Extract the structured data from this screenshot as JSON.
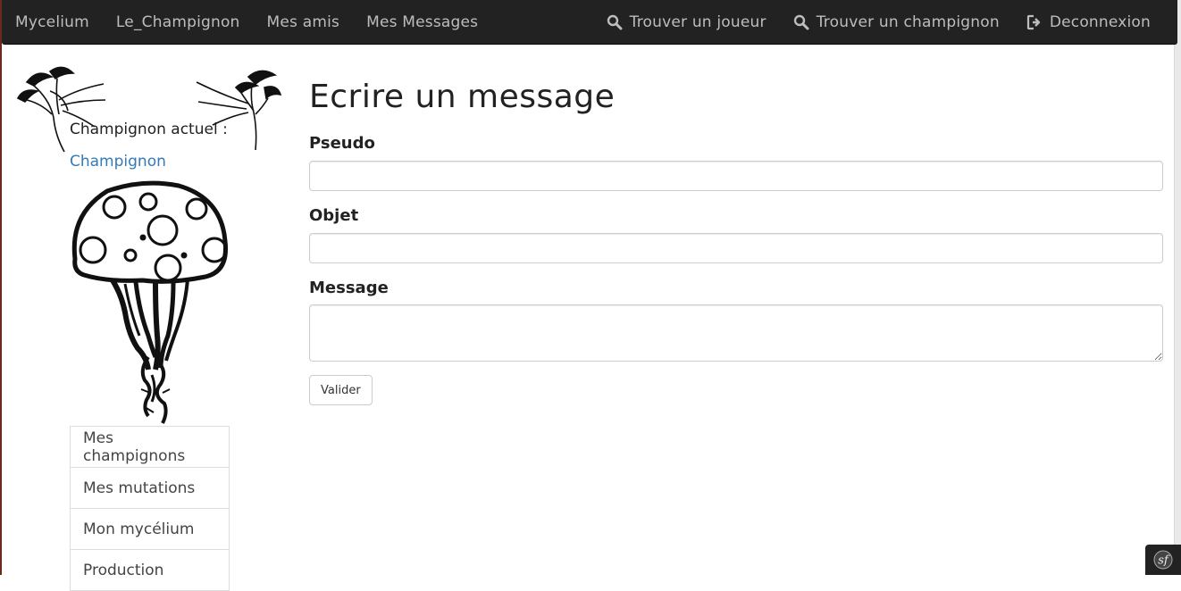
{
  "navbar": {
    "left": [
      {
        "label": "Mycelium"
      },
      {
        "label": "Le_Champignon"
      },
      {
        "label": "Mes amis"
      },
      {
        "label": "Mes Messages"
      }
    ],
    "right": [
      {
        "label": "Trouver un joueur",
        "icon": "search-icon"
      },
      {
        "label": "Trouver un champignon",
        "icon": "search-icon"
      },
      {
        "label": "Deconnexion",
        "icon": "logout-icon"
      }
    ]
  },
  "sidebar": {
    "current_label": "Champignon actuel :",
    "current_link": "Champignon",
    "menu": [
      {
        "label": "Mes champignons"
      },
      {
        "label": "Mes mutations"
      },
      {
        "label": "Mon mycélium"
      },
      {
        "label": "Production"
      }
    ]
  },
  "main": {
    "title": "Ecrire un message",
    "fields": {
      "pseudo": {
        "label": "Pseudo",
        "value": ""
      },
      "objet": {
        "label": "Objet",
        "value": ""
      },
      "message": {
        "label": "Message",
        "value": ""
      }
    },
    "submit_label": "Valider"
  },
  "colors": {
    "navbar_bg": "#222222",
    "nav_text": "#bdbdbd",
    "link": "#337ab7"
  }
}
